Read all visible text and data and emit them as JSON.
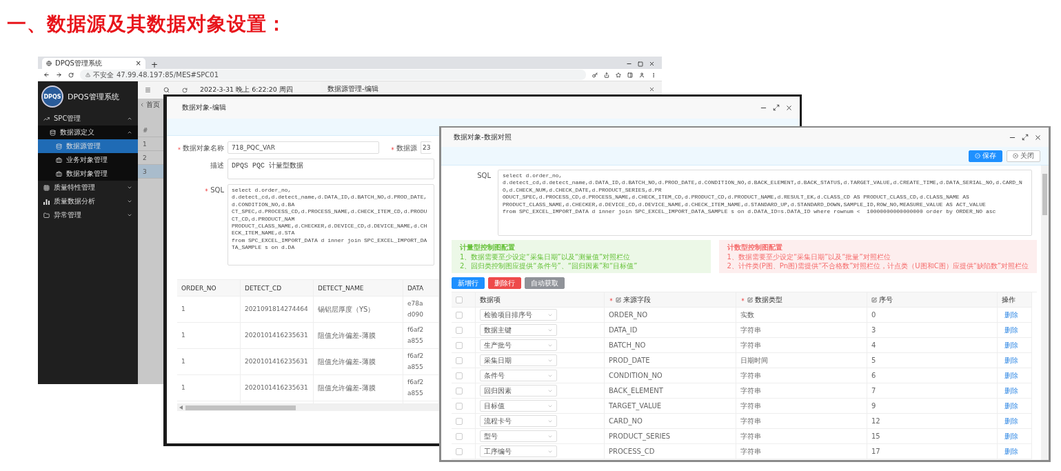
{
  "heading": "一、数据源及其数据对象设置：",
  "browser": {
    "tab_title": "DPQS管理系统",
    "tab_close": "×",
    "new_tab": "+",
    "address_warning": "不安全",
    "address": "47.99.48.197:85/MES#SPC01",
    "app_name": "DPQS管理系统",
    "logo": "DPQS",
    "datetime": "2022-3-31 晚上 6:22:20 周四",
    "home_tab": "首页",
    "sidebar": [
      {
        "label": "SPC管理",
        "expanded": true,
        "children": [
          {
            "label": "数据源定义",
            "expanded": true,
            "children": [
              {
                "label": "数据源管理",
                "selected": true
              },
              {
                "label": "业务对象管理",
                "selected": false
              },
              {
                "label": "数据对象管理",
                "selected": false
              }
            ]
          }
        ]
      },
      {
        "label": "质量特性管理",
        "expanded": false
      },
      {
        "label": "质量数据分析",
        "expanded": false
      },
      {
        "label": "异常管理",
        "expanded": false
      }
    ],
    "back_dialog_title": "数据源管理-编辑",
    "back_table": {
      "column": "#",
      "rows": [
        {
          "number": "1",
          "selected": false
        },
        {
          "number": "2",
          "selected": false
        },
        {
          "number": "3",
          "selected": true
        }
      ]
    }
  },
  "edit_dialog": {
    "title": "数据对象-编辑",
    "name_field": {
      "label": "数据对象名称",
      "required": true,
      "value": "718_PQC_VAR"
    },
    "source_field": {
      "label": "数据源",
      "required": true,
      "value": "23"
    },
    "description_field": {
      "label": "描述",
      "required": false,
      "value": "DPQS PQC 计量型数据"
    },
    "sql_field": {
      "label": "SQL",
      "required": true,
      "lines": [
        "select d.order_no,",
        "d.detect_cd,d.detect_name,d.DATA_ID,d.BATCH_NO,d.PROD_DATE,d.CONDITION_NO,d.BA",
        "CT_SPEC,d.PROCESS_CD,d.PROCESS_NAME,d.CHECK_ITEM_CD,d.PRODUCT_CD,d.PRODUCT_NAM",
        "PRODUCT_CLASS_NAME,d.CHECKER,d.DEVICE_CD,d.DEVICE_NAME,d.CHECK_ITEM_NAME,d.STA",
        "from SPC_EXCEL_IMPORT_DATA d inner join SPC_EXCEL_IMPORT_DATA_SAMPLE s on d.DA"
      ]
    },
    "preview_table": {
      "columns": [
        "ORDER_NO",
        "DETECT_CD",
        "DETECT_NAME",
        "DATA"
      ],
      "rows": [
        [
          "1",
          "2021091814274464",
          "锡铝层厚度（YS）",
          "e78a\nd090"
        ],
        [
          "1",
          "2020101416235631",
          "阻值允许偏差-薄膜",
          "f6af2\na855"
        ],
        [
          "1",
          "2020101416235631",
          "阻值允许偏差-薄膜",
          "f6af2\na855"
        ],
        [
          "1",
          "2020101416235631",
          "阻值允许偏差-薄膜",
          "f6af2\na855"
        ]
      ]
    }
  },
  "mapping_dialog": {
    "title": "数据对象-数据对照",
    "save_button": "保存",
    "close_button": "关闭",
    "sql_label": "SQL",
    "sql_lines": [
      "select d.order_no,",
      "d.detect_cd,d.detect_name,d.DATA_ID,d.BATCH_NO,d.PROD_DATE,d.CONDITION_NO,d.BACK_ELEMENT,d.BACK_STATUS,d.TARGET_VALUE,d.CREATE_TIME,d.DATA_SERIAL_NO,d.CARD_NO,d.CHECK_NUM,d.CHECK_DATE,d.PRODUCT_SERIES,d.PR",
      "ODUCT_SPEC,d.PROCESS_CD,d.PROCESS_NAME,d.CHECK_ITEM_CD,d.PRODUCT_CD,d.PRODUCT_NAME,d.RESULT_EK,d.CLASS_CD AS PRODUCT_CLASS_CD,d.CLASS_NAME AS",
      "PRODUCT_CLASS_NAME,d.CHECKER,d.DEVICE_CD,d.DEVICE_NAME,d.CHECK_ITEM_NAME,d.STANDARD_UP,d.STANDARD_DOWN,SAMPLE_ID,ROW_NO,MEASURE_VALUE AS ACT_VALUE",
      "from SPC_EXCEL_IMPORT_DATA d inner join SPC_EXCEL_IMPORT_DATA_SAMPLE s on d.DATA_ID=s.DATA_ID where rownum <  10000000000000000 order by ORDER_NO asc"
    ],
    "notices": [
      {
        "kind": "success",
        "title": "计量型控制图配置",
        "items": [
          "1、数据需要至少设定“采集日期”以及“测量值”对照栏位",
          "2、回归类控制图应提供“条件号”、“回归因素”和“目标值”"
        ]
      },
      {
        "kind": "error",
        "title": "计数型控制图配置",
        "items": [
          "1、数据需要至少设定“采集日期”以及“批量”对照栏位",
          "2、计件类(P图、Pn图)需提供“不合格数”对照栏位，计点类（U图和C图）应提供“缺陷数”对照栏位"
        ]
      }
    ],
    "actions": [
      {
        "kind": "primary",
        "label": "新增行"
      },
      {
        "kind": "danger",
        "label": "删除行"
      },
      {
        "kind": "neutral",
        "label": "自动获取"
      }
    ],
    "table": {
      "all_checked": false,
      "columns": [
        {
          "label": "数据项",
          "required": false,
          "editable": false
        },
        {
          "label": "来源字段",
          "required": true,
          "editable": true
        },
        {
          "label": "数据类型",
          "required": true,
          "editable": true
        },
        {
          "label": "序号",
          "required": false,
          "editable": true
        },
        {
          "label": "操作",
          "required": false,
          "editable": false
        }
      ],
      "rows": [
        {
          "checked": false,
          "item": "检验项目排序号",
          "source": "ORDER_NO",
          "type": "实数",
          "order": "0",
          "action": "删除"
        },
        {
          "checked": false,
          "item": "数据主键",
          "source": "DATA_ID",
          "type": "字符串",
          "order": "3",
          "action": "删除"
        },
        {
          "checked": false,
          "item": "生产批号",
          "source": "BATCH_NO",
          "type": "字符串",
          "order": "4",
          "action": "删除"
        },
        {
          "checked": false,
          "item": "采集日期",
          "source": "PROD_DATE",
          "type": "日期时间",
          "order": "5",
          "action": "删除"
        },
        {
          "checked": false,
          "item": "条件号",
          "source": "CONDITION_NO",
          "type": "字符串",
          "order": "6",
          "action": "删除"
        },
        {
          "checked": false,
          "item": "回归因素",
          "source": "BACK_ELEMENT",
          "type": "字符串",
          "order": "7",
          "action": "删除"
        },
        {
          "checked": false,
          "item": "目标值",
          "source": "TARGET_VALUE",
          "type": "字符串",
          "order": "9",
          "action": "删除"
        },
        {
          "checked": false,
          "item": "流程卡号",
          "source": "CARD_NO",
          "type": "字符串",
          "order": "12",
          "action": "删除"
        },
        {
          "checked": false,
          "item": "型号",
          "source": "PRODUCT_SERIES",
          "type": "字符串",
          "order": "15",
          "action": "删除"
        },
        {
          "checked": false,
          "item": "工序编号",
          "source": "PROCESS_CD",
          "type": "字符串",
          "order": "17",
          "action": "删除"
        }
      ]
    }
  }
}
